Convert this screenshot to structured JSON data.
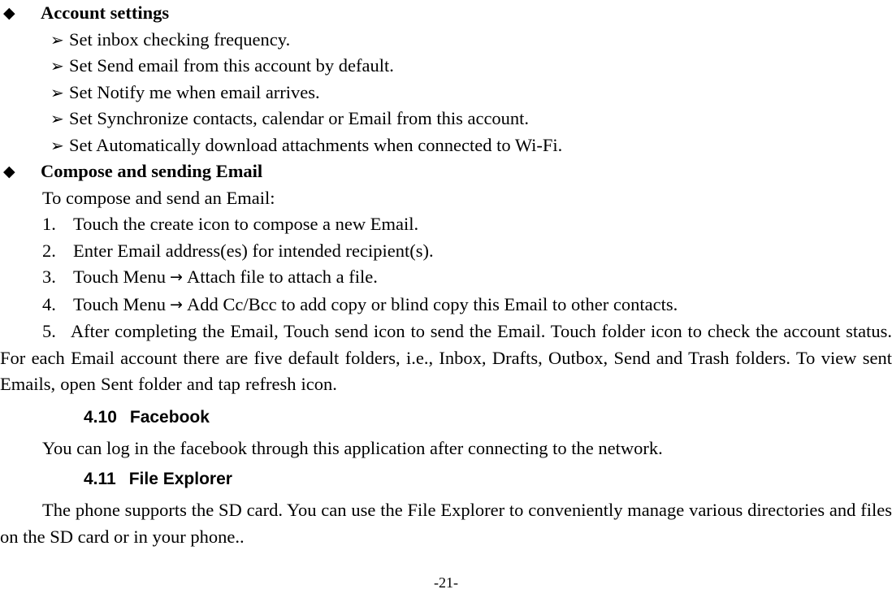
{
  "document": {
    "page_number_label": "-21-",
    "blocks": [
      {
        "type": "bullet-heading",
        "bullet": "◆",
        "text": "Account settings"
      },
      {
        "type": "sub-item",
        "bullet": "➢",
        "text": "Set inbox checking frequency."
      },
      {
        "type": "sub-item",
        "bullet": "➢",
        "text": "Set Send email from this account by default."
      },
      {
        "type": "sub-item",
        "bullet": "➢",
        "text": "Set Notify me when email arrives."
      },
      {
        "type": "sub-item",
        "bullet": "➢",
        "text": "Set Synchronize contacts, calendar or Email from this account."
      },
      {
        "type": "sub-item",
        "bullet": "➢",
        "text": "Set Automatically download attachments when connected to Wi-Fi."
      },
      {
        "type": "bullet-heading",
        "bullet": "◆",
        "text": "Compose and sending Email"
      },
      {
        "type": "plain-line",
        "text": "To compose and send an Email:"
      },
      {
        "type": "numbered",
        "number": "1.",
        "text": "Touch the create icon to compose a new Email."
      },
      {
        "type": "numbered",
        "number": "2.",
        "text": "Enter Email address(es) for intended recipient(s)."
      },
      {
        "type": "numbered-arrow",
        "number": "3.",
        "text_before": "Touch Menu",
        "arrow": "→",
        "text_after": "Attach file to attach a file."
      },
      {
        "type": "numbered-arrow",
        "number": "4.",
        "text_before": "Touch Menu",
        "arrow": "→",
        "text_after": "Add Cc/Bcc to add copy or blind copy this Email to other contacts."
      },
      {
        "type": "numbered-paragraph",
        "number": "5.",
        "text": "After completing the Email, Touch send icon to send the Email. Touch folder icon to check the account status. For each Email account there are five default folders, i.e., Inbox, Drafts, Outbox, Send and Trash folders. To view sent Emails, open Sent folder and tap refresh icon."
      },
      {
        "type": "section-heading",
        "number": "4.10",
        "title": "Facebook"
      },
      {
        "type": "paragraph",
        "text": "You can log in the facebook through this application after connecting to the network."
      },
      {
        "type": "section-heading",
        "number": "4.11",
        "title": "File Explorer"
      },
      {
        "type": "paragraph",
        "text": "The phone supports the SD card. You can use the File Explorer to conveniently manage various directories and files on the SD card or in your phone.."
      }
    ]
  }
}
